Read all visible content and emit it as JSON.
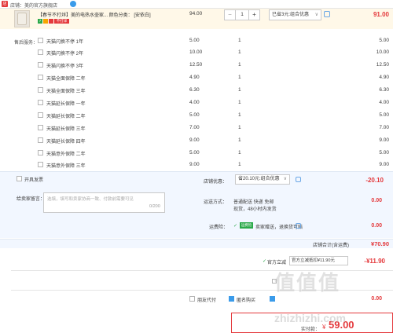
{
  "shop": {
    "icon": "shop-icon",
    "name": "店铺：美的官方旗舰店"
  },
  "item": {
    "title": "【春节不打烊】美的电热水壶家... 颜色分类： [安依白]",
    "badges": [
      "7",
      "",
      "",
      "不打烊"
    ],
    "price": "94.00",
    "quantity": "1",
    "minus": "−",
    "plus": "+",
    "discount": "已省3元:组合优惠",
    "total": "91.00"
  },
  "services": {
    "label": "售后服务：",
    "rows": [
      {
        "name": "天猫闪换不停 1年",
        "price": "5.00",
        "qty": "1",
        "sum": "5.00"
      },
      {
        "name": "天猫闪换不停 2年",
        "price": "10.00",
        "qty": "1",
        "sum": "10.00"
      },
      {
        "name": "天猫闪换不停 3年",
        "price": "12.50",
        "qty": "1",
        "sum": "12.50"
      },
      {
        "name": "天猫全面保障 二年",
        "price": "4.90",
        "qty": "1",
        "sum": "4.90"
      },
      {
        "name": "天猫全面保障 三年",
        "price": "6.30",
        "qty": "1",
        "sum": "6.30"
      },
      {
        "name": "天猫延长保障 一年",
        "price": "4.00",
        "qty": "1",
        "sum": "4.00"
      },
      {
        "name": "天猫延长保障 二年",
        "price": "5.00",
        "qty": "1",
        "sum": "5.00"
      },
      {
        "name": "天猫延长保障 三年",
        "price": "7.00",
        "qty": "1",
        "sum": "7.00"
      },
      {
        "name": "天猫延长保障 四年",
        "price": "9.00",
        "qty": "1",
        "sum": "9.00"
      },
      {
        "name": "天猫意外保障 二年",
        "price": "5.00",
        "qty": "1",
        "sum": "5.00"
      },
      {
        "name": "天猫意外保障 三年",
        "price": "9.00",
        "qty": "1",
        "sum": "9.00"
      }
    ]
  },
  "invoice": {
    "label": "开具发票"
  },
  "shop_discount": {
    "label": "店铺优惠：",
    "select": "省20.10元:组合优惠",
    "value": "-20.10"
  },
  "message": {
    "label": "给卖家留言：",
    "placeholder": "选填，填写和卖家协商一致、付款前需要可见",
    "count": "0/200"
  },
  "shipping": {
    "label": "运送方式：",
    "line1": "普通配送 快递 免邮",
    "line2": "现货，48小时内发货",
    "value": "0.00"
  },
  "insurance": {
    "label": "运费险：",
    "badge": "运费险",
    "text": "卖家赠送，退换货可赔",
    "value": "0.00"
  },
  "shop_total": {
    "label": "店铺合计(含运费)",
    "value": "¥70.90"
  },
  "tmall_discount": {
    "label": "官方立减",
    "select": "官方立减抵扣¥11.90元",
    "value": "-¥11.90"
  },
  "payment_options": {
    "friend_pay": "朋友代付",
    "anonymous": "匿名购买",
    "value": "0.00"
  },
  "final": {
    "label": "实付款：",
    "currency": "¥",
    "amount": "59.00"
  },
  "watermark": {
    "logo": "值值值",
    "url": "zhizhizhi.com"
  }
}
